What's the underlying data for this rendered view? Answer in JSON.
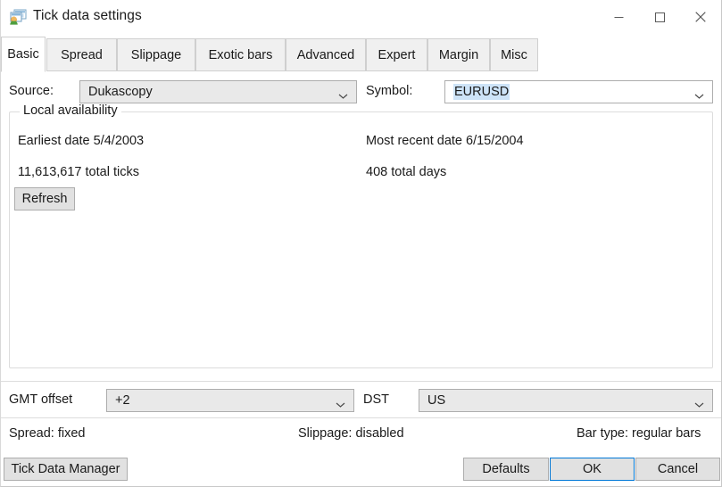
{
  "window": {
    "title": "Tick data settings",
    "icon": "tick-data-settings-icon",
    "controls": {
      "minimize": "minimize-icon",
      "maximize": "maximize-icon",
      "close": "close-icon"
    }
  },
  "tabs": [
    {
      "label": "Basic",
      "active": true
    },
    {
      "label": "Spread",
      "active": false
    },
    {
      "label": "Slippage",
      "active": false
    },
    {
      "label": "Exotic bars",
      "active": false
    },
    {
      "label": "Advanced",
      "active": false
    },
    {
      "label": "Expert",
      "active": false
    },
    {
      "label": "Margin",
      "active": false
    },
    {
      "label": "Misc",
      "active": false
    }
  ],
  "basic": {
    "source": {
      "label": "Source:",
      "value": "Dukascopy"
    },
    "symbol": {
      "label": "Symbol:",
      "value": "EURUSD"
    },
    "local_availability": {
      "title": "Local availability",
      "earliest_date": "Earliest date 5/4/2003",
      "most_recent_date": "Most recent date 6/15/2004",
      "total_ticks": "11,613,617 total ticks",
      "total_days": "408 total days",
      "refresh_label": "Refresh"
    }
  },
  "timezone": {
    "gmt_offset": {
      "label": "GMT offset",
      "value": "+2"
    },
    "dst": {
      "label": "DST",
      "value": "US"
    }
  },
  "status": {
    "spread": "Spread:  fixed",
    "slippage": "Slippage:  disabled",
    "bar_type": "Bar type:  regular bars"
  },
  "footer": {
    "tick_data_manager": "Tick Data Manager",
    "defaults": "Defaults",
    "ok": "OK",
    "cancel": "Cancel"
  },
  "colors": {
    "accent": "#0078d7",
    "selection": "#cde3f7",
    "button_face": "#e1e1e1",
    "border": "#adadad"
  }
}
